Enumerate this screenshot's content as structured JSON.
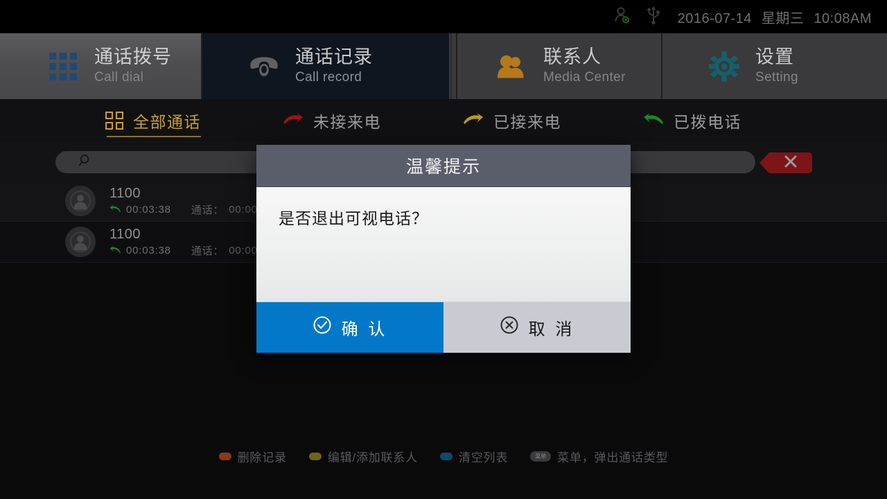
{
  "statusbar": {
    "icons": [
      "user-account-icon",
      "usb-icon"
    ],
    "date": "2016-07-14",
    "weekday": "星期三",
    "time": "10:08AM"
  },
  "tabs": [
    {
      "cn": "通话拨号",
      "en": "Call dial",
      "icon": "keypad-grid-icon",
      "active": false
    },
    {
      "cn": "通话记录",
      "en": "Call record",
      "icon": "telephone-icon",
      "active": true
    },
    {
      "cn": "联系人",
      "en": "Media Center",
      "icon": "contacts-icon",
      "active": false
    },
    {
      "cn": "设置",
      "en": "Setting",
      "icon": "gear-icon",
      "active": false
    }
  ],
  "filters": [
    {
      "label": "全部通话",
      "icon": "four-squares-icon",
      "active": true,
      "color": "#c8a12a"
    },
    {
      "label": "未接来电",
      "icon": "arrow-missed-icon",
      "active": false,
      "color": "#9e1416"
    },
    {
      "label": "已接来电",
      "icon": "arrow-received-icon",
      "active": false,
      "color": "#b59a24"
    },
    {
      "label": "已拨电话",
      "icon": "arrow-dialed-icon",
      "active": false,
      "color": "#168a20"
    }
  ],
  "search": {
    "icon": "search-icon",
    "value": "",
    "placeholder": "",
    "clear_icon": "close-x-icon"
  },
  "call_list": [
    {
      "number": "1100",
      "direction_icon": "outgoing-call-icon",
      "time": "00:03:38",
      "duration_label": "通话：",
      "duration": "00:00"
    },
    {
      "number": "1100",
      "direction_icon": "outgoing-call-icon",
      "time": "00:03:38",
      "duration_label": "通话：",
      "duration": "00:00"
    }
  ],
  "hints": [
    {
      "label": "删除记录",
      "color": "#8a3a18",
      "badge": null
    },
    {
      "label": "编辑/添加联系人",
      "color": "#6e6410",
      "badge": null
    },
    {
      "label": "清空列表",
      "color": "#0d4a6b",
      "badge": null
    },
    {
      "label": "菜单，弹出通话类型",
      "color": null,
      "badge": "菜单"
    }
  ],
  "dialog": {
    "title": "温馨提示",
    "message": "是否退出可视电话？",
    "confirm": {
      "label": "确 认",
      "icon": "check-circle-icon",
      "color": "#0478c8"
    },
    "cancel": {
      "label": "取 消",
      "icon": "cancel-circle-icon",
      "color": "#c8ccd2"
    }
  }
}
